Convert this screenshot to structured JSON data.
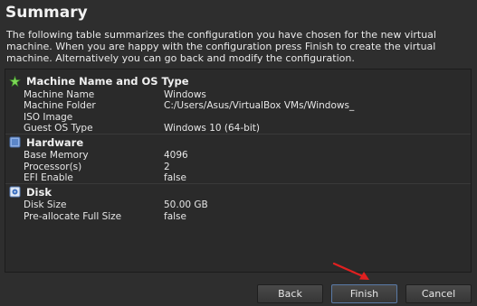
{
  "header": {
    "title": "Summary",
    "description": "The following table summarizes the configuration you have chosen for the new virtual machine. When you are happy with the configuration press Finish to create the virtual machine. Alternatively you can go back and modify the configuration."
  },
  "sections": [
    {
      "icon": "machine-icon",
      "title": "Machine Name and OS Type",
      "rows": [
        {
          "key": "Machine Name",
          "value": "Windows"
        },
        {
          "key": "Machine Folder",
          "value": "C:/Users/Asus/VirtualBox VMs/Windows_"
        },
        {
          "key": "ISO Image",
          "value": ""
        },
        {
          "key": "Guest OS Type",
          "value": "Windows 10 (64-bit)"
        }
      ]
    },
    {
      "icon": "hardware-icon",
      "title": "Hardware",
      "rows": [
        {
          "key": "Base Memory",
          "value": "4096"
        },
        {
          "key": "Processor(s)",
          "value": "2"
        },
        {
          "key": "EFI Enable",
          "value": "false"
        }
      ]
    },
    {
      "icon": "disk-icon",
      "title": "Disk",
      "rows": [
        {
          "key": "Disk Size",
          "value": "50.00 GB"
        },
        {
          "key": "Pre-allocate Full Size",
          "value": "false"
        }
      ]
    }
  ],
  "buttons": {
    "back": "Back",
    "finish": "Finish",
    "cancel": "Cancel"
  }
}
